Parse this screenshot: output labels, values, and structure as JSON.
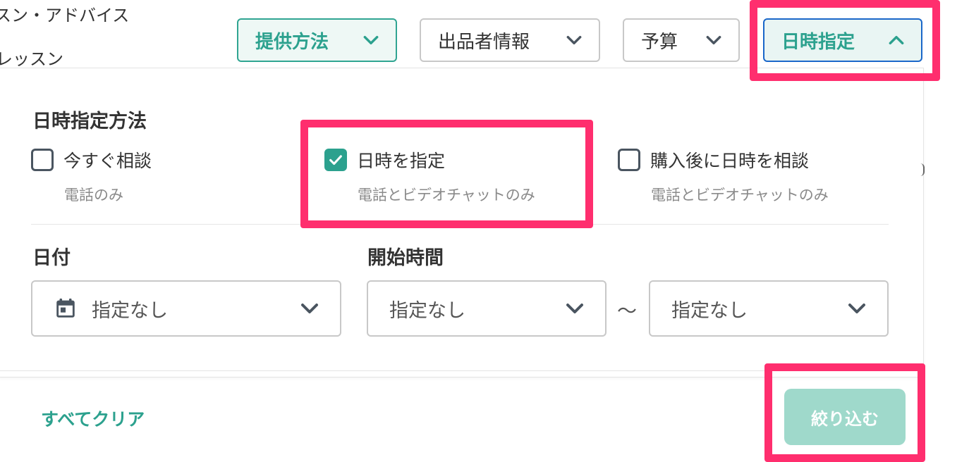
{
  "background": {
    "line1": "スン・アドバイス",
    "line2": "レッスン"
  },
  "filters": [
    {
      "label": "提供方法",
      "state": "active",
      "icon": "chevron-down-icon"
    },
    {
      "label": "出品者情報",
      "state": "default",
      "icon": "chevron-down-icon"
    },
    {
      "label": "予算",
      "state": "default",
      "icon": "chevron-down-icon"
    },
    {
      "label": "日時指定",
      "state": "open",
      "icon": "chevron-up-icon"
    }
  ],
  "panel": {
    "method_title": "日時指定方法",
    "options": [
      {
        "label": "今すぐ相談",
        "sub": "電話のみ",
        "checked": false
      },
      {
        "label": "日時を指定",
        "sub": "電話とビデオチャットのみ",
        "checked": true
      },
      {
        "label": "購入後に日時を相談",
        "sub": "電話とビデオチャットのみ",
        "checked": false
      }
    ],
    "date_title": "日付",
    "date_value": "指定なし",
    "start_title": "開始時間",
    "start_from": "指定なし",
    "range_sep": "〜",
    "start_to": "指定なし"
  },
  "footer": {
    "clear_label": "すべてクリア",
    "apply_label": "絞り込む"
  },
  "colors": {
    "accent": "#2ca18e",
    "highlight": "#ff2e6e",
    "focus_border": "#1a67c9",
    "apply_disabled": "#9fd9cb"
  }
}
